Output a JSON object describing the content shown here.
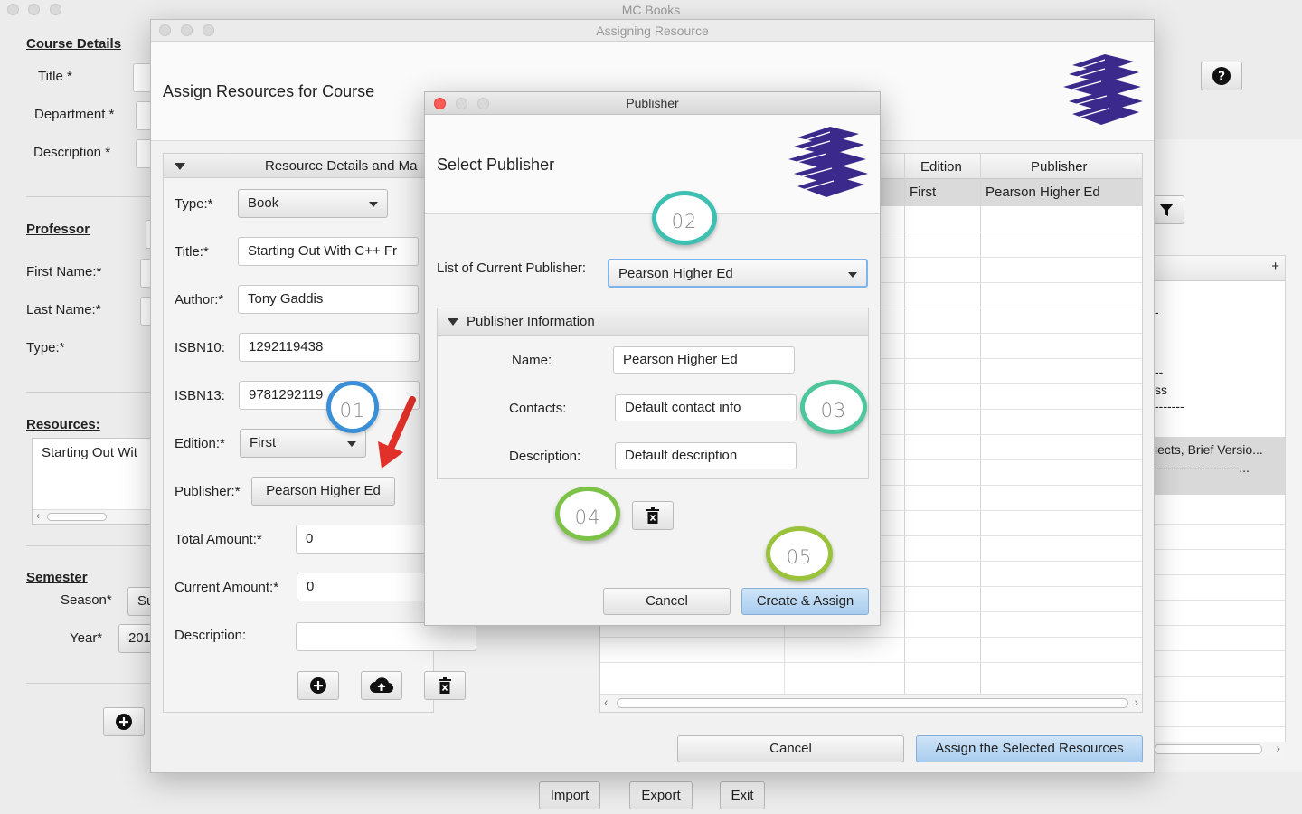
{
  "main_window": {
    "title": "MC Books",
    "course_details": {
      "heading": "Course Details",
      "title_label": "Title *",
      "department_label": "Department *",
      "description_label": "Description *"
    },
    "professor": {
      "heading": "Professor",
      "first_name_label": "First Name:*",
      "last_name_label": "Last Name:*",
      "type_label": "Type:*"
    },
    "resources": {
      "heading": "Resources:",
      "item": "Starting Out Wit"
    },
    "semester": {
      "heading": "Semester",
      "season_label": "Season*",
      "season_value": "Su",
      "year_label": "Year*",
      "year_value": "201"
    },
    "right_fragments": {
      "line1": "-",
      "line2": "--",
      "line3": "ss",
      "line4": "-------",
      "line5": "iects, Brief Versio...",
      "line6": "--------------------..."
    },
    "bottom_buttons": {
      "import": "Import",
      "export": "Export",
      "exit": "Exit"
    }
  },
  "assign_window": {
    "title": "Assigning Resource",
    "heading": "Assign Resources for Course",
    "section_title": "Resource Details and Ma",
    "form": {
      "type_label": "Type:*",
      "type_value": "Book",
      "title_label": "Title:*",
      "title_value": "Starting Out With C++ Fr",
      "author_label": "Author:*",
      "author_value": "Tony Gaddis",
      "isbn10_label": "ISBN10:",
      "isbn10_value": "1292119438",
      "isbn13_label": "ISBN13:",
      "isbn13_value": "9781292119",
      "edition_label": "Edition:*",
      "edition_value": "First",
      "publisher_label": "Publisher:*",
      "publisher_value": "Pearson Higher Ed",
      "total_amount_label": "Total Amount:*",
      "total_amount_value": "0",
      "current_amount_label": "Current Amount:*",
      "current_amount_value": "0",
      "description_label": "Description:",
      "description_value": ""
    },
    "table": {
      "columns": [
        "Edition",
        "Publisher"
      ],
      "rows": [
        [
          "First",
          "Pearson Higher Ed"
        ]
      ]
    },
    "cancel_label": "Cancel",
    "assign_label": "Assign the Selected Resources"
  },
  "publisher_dialog": {
    "title": "Publisher",
    "heading": "Select Publisher",
    "list_label": "List of Current Publisher:",
    "list_value": "Pearson Higher Ed",
    "info_section": "Publisher Information",
    "name_label": "Name:",
    "name_value": "Pearson Higher Ed",
    "contacts_label": "Contacts:",
    "contacts_value": "Default contact info",
    "description_label": "Description:",
    "description_value": "Default description",
    "cancel_label": "Cancel",
    "create_label": "Create & Assign"
  },
  "annotations": [
    "01",
    "02",
    "03",
    "04",
    "05"
  ],
  "colors": {
    "accent_blue": "#a9cdef",
    "logo_purple": "#3b2a8c",
    "badge_blue": "#3a8fd6",
    "badge_teal": "#3dbfb2",
    "badge_green": "#7cc247",
    "arrow_red": "#e2302a"
  }
}
